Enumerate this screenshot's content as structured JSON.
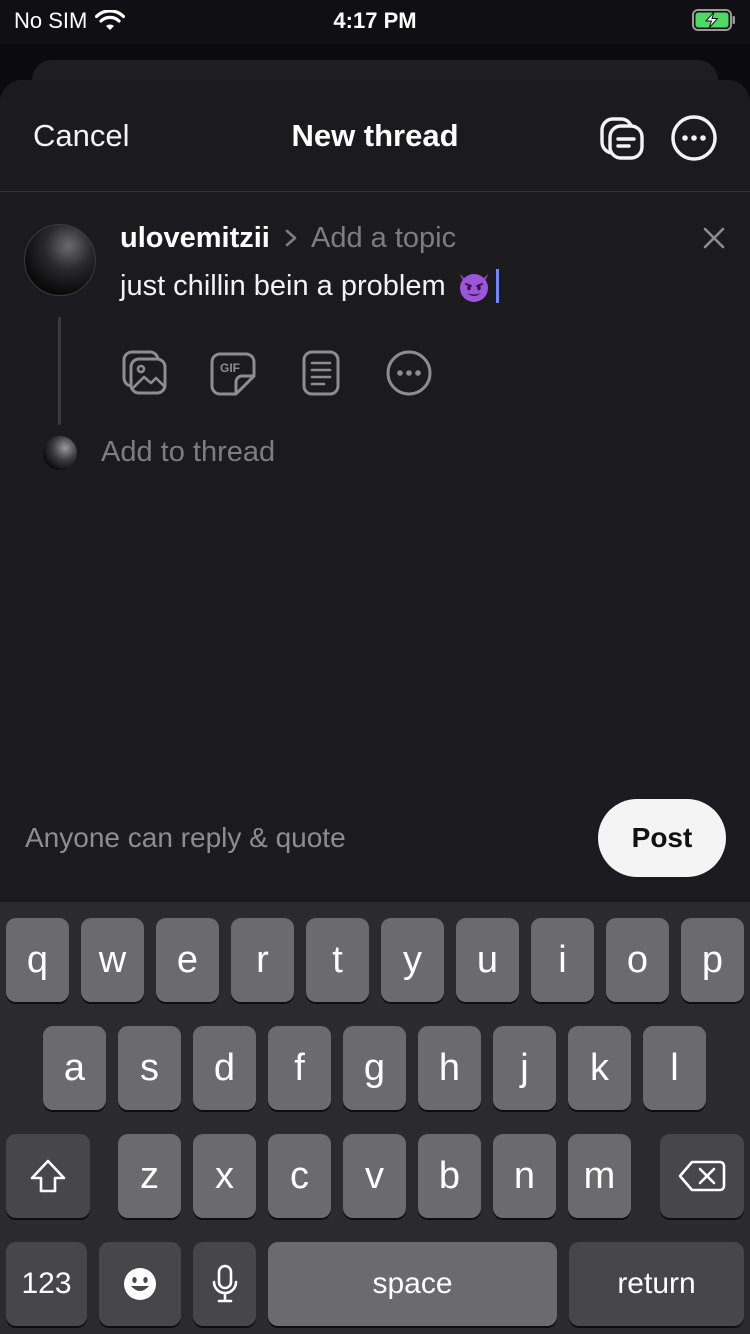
{
  "status_bar": {
    "carrier": "No SIM",
    "time": "4:17 PM"
  },
  "nav": {
    "cancel_label": "Cancel",
    "title": "New thread"
  },
  "post": {
    "username": "ulovemitzii",
    "topic_placeholder": "Add a topic",
    "text": "just chillin bein a problem"
  },
  "add_to_thread_placeholder": "Add to thread",
  "reply_setting": "Anyone can reply & quote",
  "post_button": "Post",
  "keyboard": {
    "row1": [
      "q",
      "w",
      "e",
      "r",
      "t",
      "y",
      "u",
      "i",
      "o",
      "p"
    ],
    "row2": [
      "a",
      "s",
      "d",
      "f",
      "g",
      "h",
      "j",
      "k",
      "l"
    ],
    "row3": [
      "z",
      "x",
      "c",
      "v",
      "b",
      "n",
      "m"
    ],
    "numbers_label": "123",
    "space_label": "space",
    "return_label": "return"
  }
}
